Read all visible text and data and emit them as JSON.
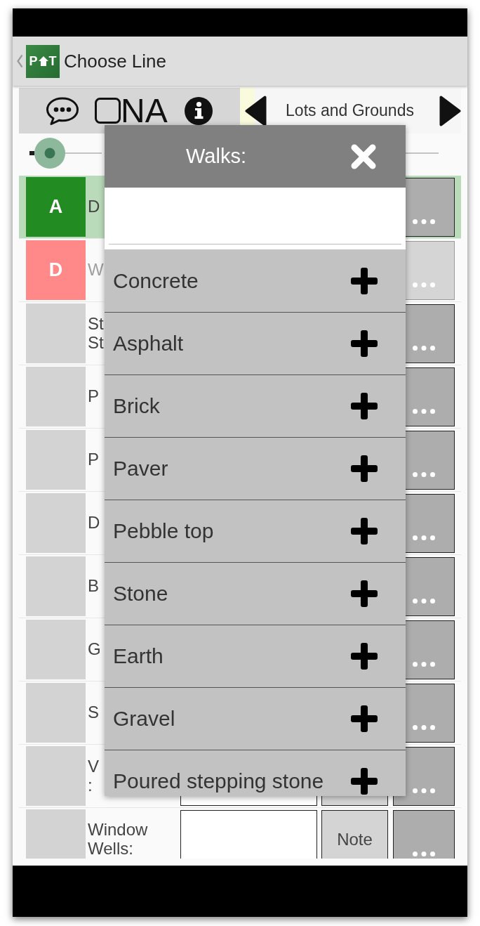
{
  "header": {
    "title": "Choose Line",
    "logo": {
      "left": "P",
      "right": "T"
    }
  },
  "toolbar": {
    "na": {
      "label": "NA",
      "checked": false
    },
    "section": "Lots and Grounds"
  },
  "slider": {
    "level": 0.05
  },
  "rows": [
    {
      "grade": "A",
      "color": "#228b22",
      "label": "D",
      "selected": true,
      "disabled": false,
      "fields_visible": false
    },
    {
      "grade": "D",
      "color": "#ff8888",
      "label": "W",
      "selected": false,
      "disabled": true,
      "fields_visible": false
    },
    {
      "color": "#d3d3d3",
      "label": "St St",
      "selected": false,
      "disabled": false,
      "fields_visible": false
    },
    {
      "color": "#d3d3d3",
      "label": "P",
      "selected": false,
      "disabled": false,
      "fields_visible": false
    },
    {
      "color": "#d3d3d3",
      "label": "P",
      "selected": false,
      "disabled": false,
      "fields_visible": false
    },
    {
      "color": "#d3d3d3",
      "label": "D",
      "selected": false,
      "disabled": false,
      "fields_visible": false
    },
    {
      "color": "#d3d3d3",
      "label": "B",
      "selected": false,
      "disabled": false,
      "fields_visible": false
    },
    {
      "color": "#d3d3d3",
      "label": "G",
      "selected": false,
      "disabled": false,
      "fields_visible": false
    },
    {
      "color": "#d3d3d3",
      "label": "S",
      "selected": false,
      "disabled": false,
      "fields_visible": false
    },
    {
      "color": "#d3d3d3",
      "label": "V :",
      "selected": false,
      "disabled": false,
      "fields_visible": true
    },
    {
      "color": "#d3d3d3",
      "label": "Window Wells:",
      "selected": false,
      "disabled": false,
      "fields_visible": true,
      "note_label": "Note"
    }
  ],
  "dialog": {
    "title": "Walks:",
    "options": [
      "Concrete",
      "Asphalt",
      "Brick",
      "Paver",
      "Pebble top",
      "Stone",
      "Earth",
      "Gravel",
      "Poured stepping stone"
    ]
  }
}
